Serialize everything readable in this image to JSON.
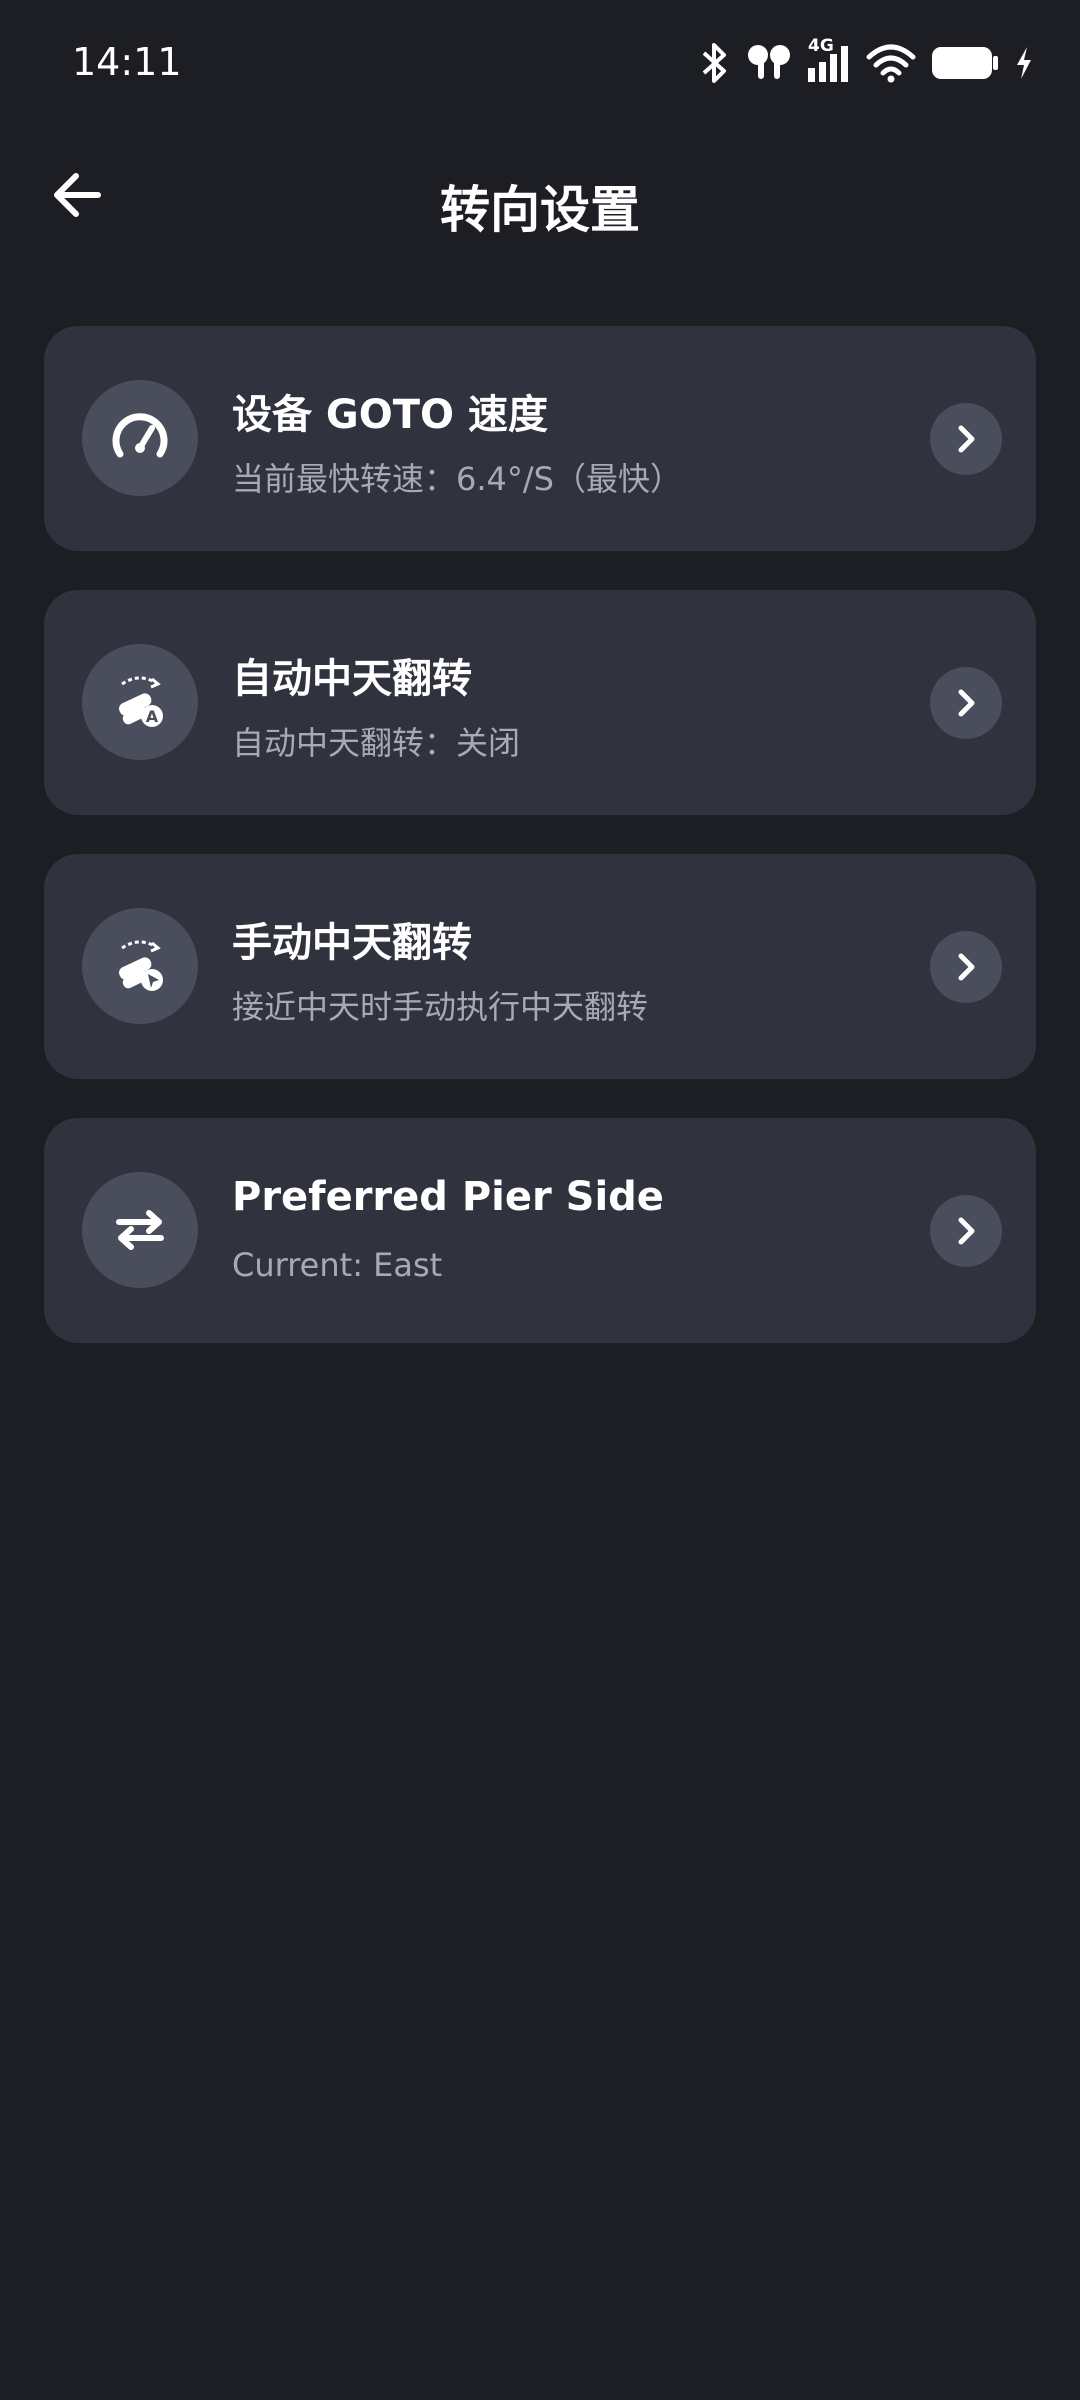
{
  "status_bar": {
    "time": "14:11",
    "network": "4G",
    "icons": [
      "bluetooth-icon",
      "earbuds-icon",
      "signal-icon",
      "wifi-icon",
      "battery-icon",
      "charging-icon"
    ]
  },
  "header": {
    "title": "转向设置",
    "back_icon": "arrow-left-icon"
  },
  "items": [
    {
      "title": "设备 GOTO 速度",
      "subtitle": "当前最快转速：6.4°/S（最快）",
      "icon": "speedometer-icon"
    },
    {
      "title": "自动中天翻转",
      "subtitle": "自动中天翻转：关闭",
      "icon": "auto-meridian-flip-icon"
    },
    {
      "title": "手动中天翻转",
      "subtitle": "接近中天时手动执行中天翻转",
      "icon": "manual-meridian-flip-icon"
    },
    {
      "title": "Preferred Pier Side",
      "subtitle": "Current: East",
      "icon": "swap-arrows-icon"
    }
  ],
  "colors": {
    "background": "#1d1e23",
    "card": "#30323d",
    "icon_circle": "#4a4e5c",
    "subtitle": "#a7aab3"
  }
}
